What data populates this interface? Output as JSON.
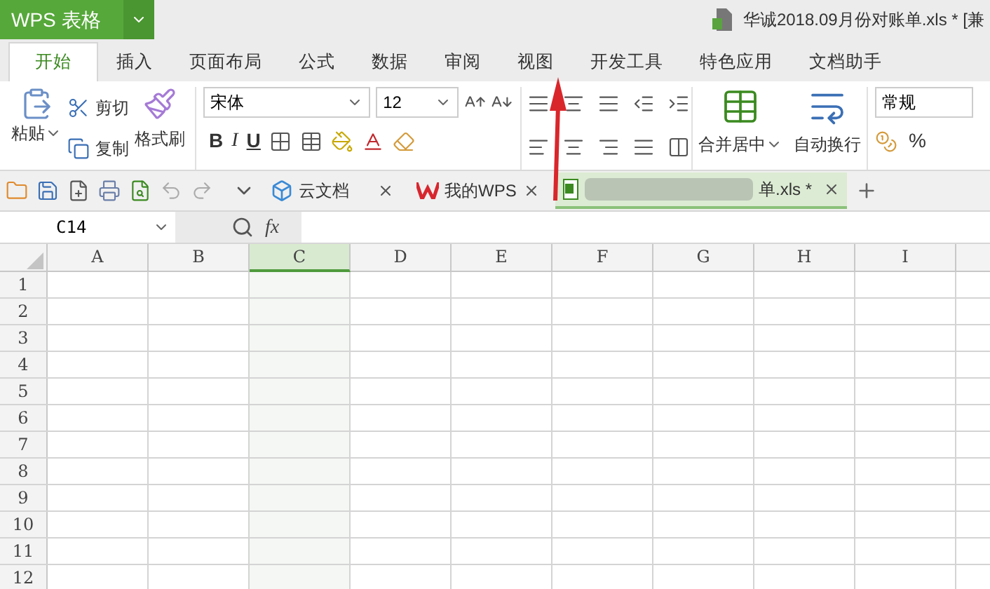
{
  "app_menu": {
    "label": "WPS 表格"
  },
  "window": {
    "title": "华诚2018.09月份对账单.xls * [兼"
  },
  "ribbon_tabs": [
    {
      "label": "开始",
      "selected": true
    },
    {
      "label": "插入",
      "selected": false
    },
    {
      "label": "页面布局",
      "selected": false
    },
    {
      "label": "公式",
      "selected": false
    },
    {
      "label": "数据",
      "selected": false
    },
    {
      "label": "审阅",
      "selected": false
    },
    {
      "label": "视图",
      "selected": false
    },
    {
      "label": "开发工具",
      "selected": false
    },
    {
      "label": "特色应用",
      "selected": false
    },
    {
      "label": "文档助手",
      "selected": false
    }
  ],
  "clipboard": {
    "paste": "粘贴",
    "cut": "剪切",
    "copy": "复制",
    "format_painter": "格式刷"
  },
  "font": {
    "name": "宋体",
    "size": "12",
    "bold": "B",
    "italic": "I",
    "underline": "U"
  },
  "alignment": {
    "merge": "合并居中",
    "wrap": "自动换行"
  },
  "number": {
    "format": "常规",
    "percent": "%"
  },
  "doc_tabs": [
    {
      "label": "云文档",
      "kind": "cloud",
      "selected": false
    },
    {
      "label": "我的WPS",
      "kind": "wps",
      "selected": false
    },
    {
      "label": "单.xls *",
      "kind": "sheet",
      "selected": true
    }
  ],
  "formula_bar": {
    "cell_ref": "C14",
    "fx": "fx"
  },
  "columns": [
    {
      "label": "A",
      "selected": false
    },
    {
      "label": "B",
      "selected": false
    },
    {
      "label": "C",
      "selected": true
    },
    {
      "label": "D",
      "selected": false
    },
    {
      "label": "E",
      "selected": false
    },
    {
      "label": "F",
      "selected": false
    },
    {
      "label": "G",
      "selected": false
    },
    {
      "label": "H",
      "selected": false
    },
    {
      "label": "I",
      "selected": false
    }
  ],
  "rows": [
    "1",
    "2",
    "3",
    "4",
    "5",
    "6",
    "7",
    "8",
    "9",
    "10",
    "11",
    "12"
  ]
}
